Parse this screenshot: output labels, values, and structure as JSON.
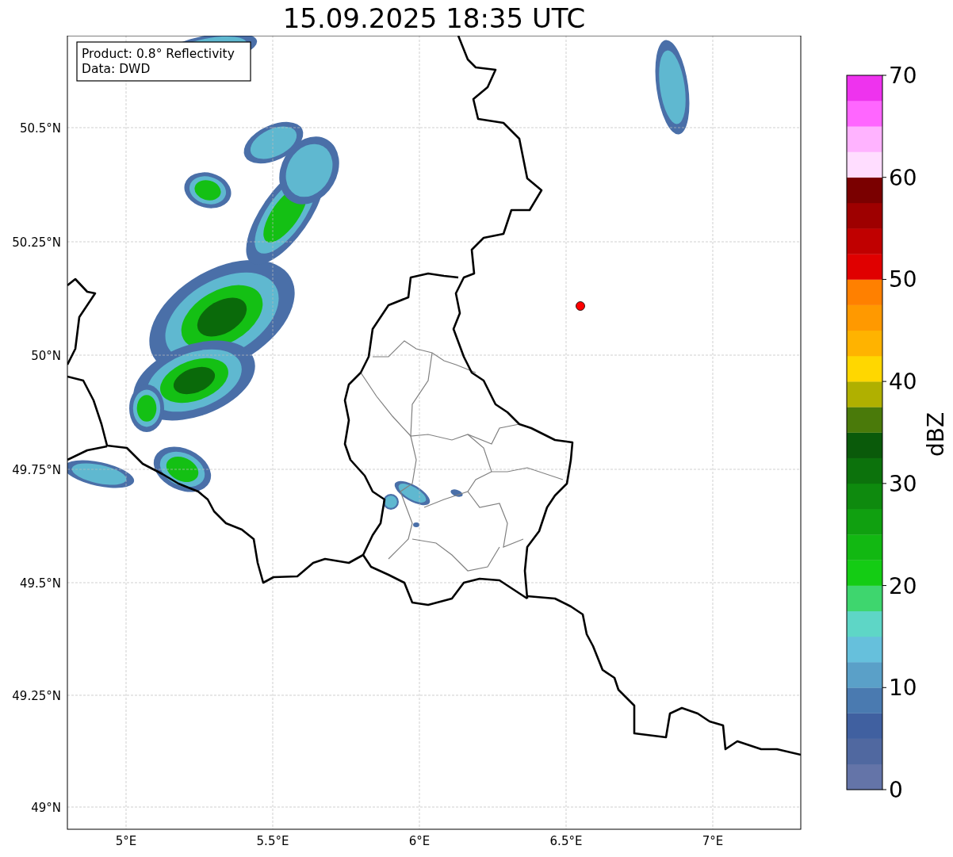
{
  "title": "15.09.2025 18:35 UTC",
  "map": {
    "info_box": {
      "lines": [
        "Product: 0.8° Reflectivity",
        "Data: DWD"
      ]
    },
    "y_ticks": [
      "50.5°N",
      "50.25°N",
      "50°N",
      "49.75°N",
      "49.5°N",
      "49.25°N",
      "49°N"
    ],
    "x_ticks": [
      "5°E",
      "5.5°E",
      "6°E",
      "6.5°E",
      "7°E"
    ]
  },
  "colorbar": {
    "label": "dBZ",
    "ticks": [
      "70",
      "60",
      "50",
      "40",
      "30",
      "20",
      "10",
      "0"
    ],
    "bands": [
      {
        "color": "#6474a8"
      },
      {
        "color": "#5068a0"
      },
      {
        "color": "#4060a0"
      },
      {
        "color": "#4a7ab0"
      },
      {
        "color": "#5aa0c8"
      },
      {
        "color": "#66c0dc"
      },
      {
        "color": "#5ed6c6"
      },
      {
        "color": "#3ed66e"
      },
      {
        "color": "#14cc14"
      },
      {
        "color": "#12b812"
      },
      {
        "color": "#10a010"
      },
      {
        "color": "#0e8a0e"
      },
      {
        "color": "#0c720c"
      },
      {
        "color": "#0a5a0a"
      },
      {
        "color": "#4a7a0a"
      },
      {
        "color": "#b0b000"
      },
      {
        "color": "#ffd700"
      },
      {
        "color": "#ffb300"
      },
      {
        "color": "#ff9900"
      },
      {
        "color": "#ff8000"
      },
      {
        "color": "#e00000"
      },
      {
        "color": "#c00000"
      },
      {
        "color": "#9e0000"
      },
      {
        "color": "#7a0000"
      },
      {
        "color": "#ffddff"
      },
      {
        "color": "#ffb3ff"
      },
      {
        "color": "#ff66ff"
      },
      {
        "color": "#ee33ee"
      }
    ]
  }
}
